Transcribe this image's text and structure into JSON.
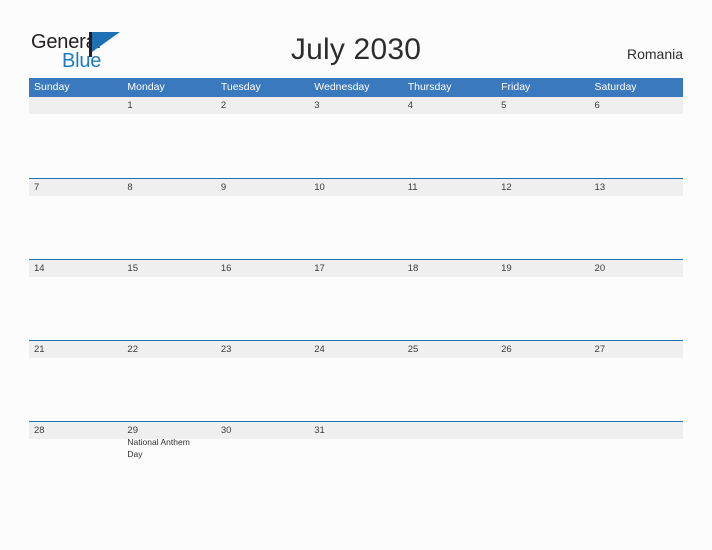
{
  "brand": {
    "name_part1": "General",
    "name_part2": "Blue",
    "flag_color": "#1f6fb5",
    "blue_text_color": "#1f7bc1"
  },
  "header": {
    "title": "July 2030",
    "region": "Romania"
  },
  "calendar": {
    "header_color": "#3a79bd",
    "band_color": "#efefef",
    "rule_color": "#1f6fb5",
    "weekdays": [
      "Sunday",
      "Monday",
      "Tuesday",
      "Wednesday",
      "Thursday",
      "Friday",
      "Saturday"
    ],
    "weeks": [
      [
        {
          "day": ""
        },
        {
          "day": "1"
        },
        {
          "day": "2"
        },
        {
          "day": "3"
        },
        {
          "day": "4"
        },
        {
          "day": "5"
        },
        {
          "day": "6"
        }
      ],
      [
        {
          "day": "7"
        },
        {
          "day": "8"
        },
        {
          "day": "9"
        },
        {
          "day": "10"
        },
        {
          "day": "11"
        },
        {
          "day": "12"
        },
        {
          "day": "13"
        }
      ],
      [
        {
          "day": "14"
        },
        {
          "day": "15"
        },
        {
          "day": "16"
        },
        {
          "day": "17"
        },
        {
          "day": "18"
        },
        {
          "day": "19"
        },
        {
          "day": "20"
        }
      ],
      [
        {
          "day": "21"
        },
        {
          "day": "22"
        },
        {
          "day": "23"
        },
        {
          "day": "24"
        },
        {
          "day": "25"
        },
        {
          "day": "26"
        },
        {
          "day": "27"
        }
      ],
      [
        {
          "day": "28"
        },
        {
          "day": "29",
          "event": "National Anthem Day"
        },
        {
          "day": "30"
        },
        {
          "day": "31"
        },
        {
          "day": ""
        },
        {
          "day": ""
        },
        {
          "day": ""
        }
      ]
    ]
  }
}
